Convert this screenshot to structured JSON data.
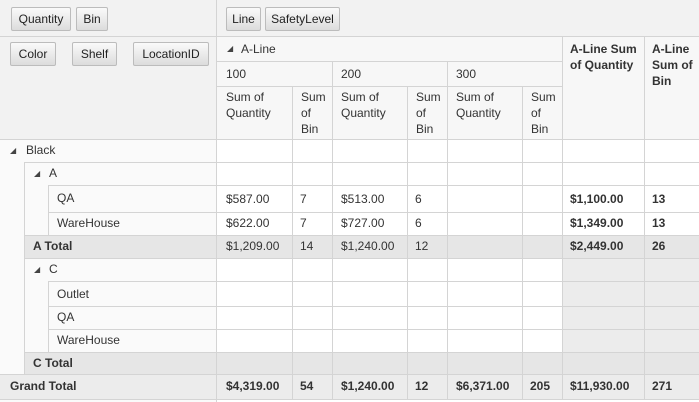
{
  "filter_fields": {
    "quantity": "Quantity",
    "bin": "Bin"
  },
  "column_fields": {
    "line": "Line",
    "safety_level": "SafetyLevel"
  },
  "row_fields": {
    "color": "Color",
    "shelf": "Shelf",
    "location_id": "LocationID"
  },
  "column_header": {
    "group": "A-Line",
    "sub_groups": [
      "100",
      "200",
      "300"
    ],
    "measures": [
      "Sum of Quantity",
      "Sum of Bin"
    ],
    "total_quantity": "A-Line Sum of Quantity",
    "total_bin": "A-Line Sum of Bin"
  },
  "rows": {
    "black": {
      "label": "Black"
    },
    "a": {
      "label": "A"
    },
    "qa_a": {
      "label": "QA",
      "values": [
        "$587.00",
        "7",
        "$513.00",
        "6",
        "",
        "",
        "$1,100.00",
        "13"
      ]
    },
    "warehouse_a": {
      "label": "WareHouse",
      "values": [
        "$622.00",
        "7",
        "$727.00",
        "6",
        "",
        "",
        "$1,349.00",
        "13"
      ]
    },
    "a_total": {
      "label": "A Total",
      "values": [
        "$1,209.00",
        "14",
        "$1,240.00",
        "12",
        "",
        "",
        "$2,449.00",
        "26"
      ]
    },
    "c": {
      "label": "C"
    },
    "outlet": {
      "label": "Outlet"
    },
    "qa_c": {
      "label": "QA"
    },
    "warehouse_c": {
      "label": "WareHouse"
    },
    "c_total": {
      "label": "C Total"
    },
    "grand_total": {
      "label": "Grand Total",
      "values": [
        "$4,319.00",
        "54",
        "$1,240.00",
        "12",
        "$6,371.00",
        "205",
        "$11,930.00",
        "271"
      ]
    }
  }
}
